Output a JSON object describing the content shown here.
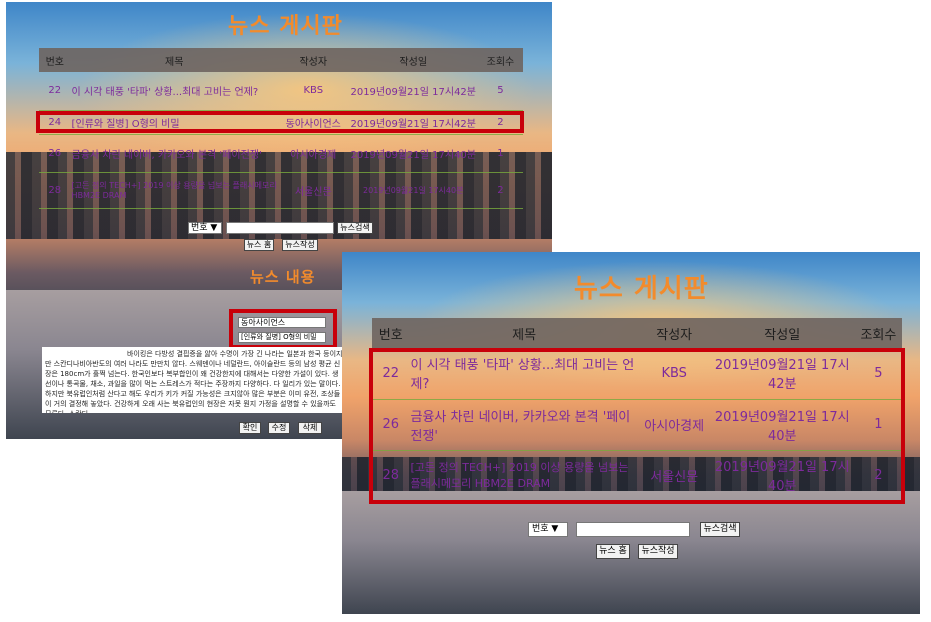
{
  "board_title": "뉴스 게시판",
  "columns": [
    "번호",
    "제목",
    "작성자",
    "작성일",
    "조회수"
  ],
  "left": {
    "rows": [
      {
        "no": "22",
        "title": "이 시각 태풍 '타파' 상황...최대 고비는 언제?",
        "author": "KBS",
        "date": "2019년09월21일 17시42분",
        "views": "5"
      },
      {
        "no": "24",
        "title": "[인류와 질병] O형의 비밀",
        "author": "동아사이언스",
        "date": "2019년09월21일 17시42분",
        "views": "2"
      },
      {
        "no": "26",
        "title": "금융사 차린 네이버, 카카오와 본격 '페이전쟁'",
        "author": "아시아경제",
        "date": "2019년09월21일 17시40분",
        "views": "1"
      },
      {
        "no": "28",
        "title": "[고든 정의 TECH+] 2019 이상 용량을 넘보는 플래시메모리 HBM2E DRAM",
        "author": "서울신문",
        "date": "2019년09월21일 17시40분",
        "views": "2"
      }
    ],
    "search": {
      "select": "번호 ▼",
      "input": "",
      "search_btn": "뉴스검색",
      "home_btn": "뉴스 홈",
      "write_btn": "뉴스작성"
    },
    "content_section_title": "뉴스 내용",
    "content_author": "동아사이언스",
    "content_title": "[인류와 질병] O형의 비밀",
    "content_text": "바이킹은 다방성 결핍증을 앓아 수명이 가장 긴 나라는 일본과 한국 등이지만 스칸디나비아반도의 여러 나라도 만만치 않다. 스웨덴이나 네덜란드, 아이슬란드 등의 남성 평균 신장은 180cm가 훌쩍 넘는다. 한국인보다 복부합인이 왜 건강한지에 대해서는 다양한 가설이 있다. 생선이나 통곡물, 채소, 과일을 많이 먹는 스트레스가 적다는 주장까지 다양하다. 다 일리가 있는 말이다. 하지만 북유럽인처럼 산다고 해도 우리가 키가 커질 가능성은 크지않아 많은 부분은 이미 유전, 조상들이 거의 결정해 놓았다. 건강하게 오래 사는 북유럽인의 현장은 자못 뭔지 가정을 설명할 수 있을까도 모른다. 스칸디",
    "action_buttons": [
      "확인",
      "수정",
      "삭제"
    ]
  },
  "right": {
    "rows": [
      {
        "no": "22",
        "title": "이 시각 태풍 '타파' 상황...최대 고비는 언제?",
        "author": "KBS",
        "date": "2019년09월21일 17시42분",
        "views": "5"
      },
      {
        "no": "26",
        "title": "금융사 차린 네이버, 카카오와 본격 '페이전쟁'",
        "author": "아시아경제",
        "date": "2019년09월21일 17시40분",
        "views": "1"
      },
      {
        "no": "28",
        "title": "[고든 정의 TECH+] 2019 이상 용량을 넘보는 플래시메모리 HBM2E DRAM",
        "author": "서울신문",
        "date": "2019년09월21일 17시40분",
        "views": "2"
      }
    ],
    "search": {
      "select": "번호 ▼",
      "input": "",
      "search_btn": "뉴스검색",
      "home_btn": "뉴스 홈",
      "write_btn": "뉴스작성"
    }
  },
  "colors": {
    "title": "#f28b2c",
    "link": "#7d2a9c",
    "highlight": "#c8000a",
    "header": "#6e645f"
  }
}
